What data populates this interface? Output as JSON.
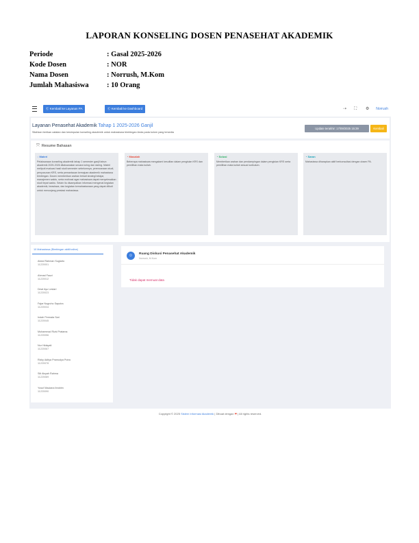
{
  "report": {
    "title": "LAPORAN KONSELING DOSEN PENASEHAT AKADEMIK",
    "fields": [
      {
        "label": "Periode",
        "value": ": Gasal 2025-2026"
      },
      {
        "label": "Kode Dosen",
        "value": ": NOR"
      },
      {
        "label": "Nama Dosen",
        "value": ": Norrush, M.Kom"
      },
      {
        "label": "Jumlah Mahasiswa",
        "value": ": 10 Orang"
      }
    ]
  },
  "app": {
    "topbar": {
      "btn1": "Ⓒ Kembali ke Layanan PA",
      "btn2": "Ⓒ Kembali ke Dashboard",
      "user": "Norrush"
    },
    "header": {
      "title": "Layanan Penasehat Akademik",
      "title_highlight": "Tahap 1 2025-2026 Ganjil",
      "subtitle": "Silahkan berikan catatan dan kesimpulan konseling akademik untuk mahasiswa bimbingan Anda pada kolom yang tersedia",
      "updated": "Update terakhir: 17/09/2025 15:39",
      "back": "Kembali"
    },
    "summary": {
      "title": "Resume Bahasan",
      "cols": [
        {
          "heading": "Materi",
          "color": "#3b7ddd",
          "text": "Pelaksanaan konseling akademik tahap 1 semester ganjil tahun akademik 2025-2026 dilaksanakan secara luring dan daring. Materi meliputi evaluasi hasil studi semester sebelumnya, perencanaan studi, penyusunan KRS, serta pemantauan kemajuan akademik mahasiswa bimbingan. Dosen memberikan arahan terkait strategi belajar, manajemen waktu, serta motivasi agar mahasiswa dapat menyelesaikan studi tepat waktu. Selain itu disampaikan informasi mengenai kegiatan akademik, beasiswa, dan kegiatan kemahasiswaan yang dapat diikuti untuk menunjang prestasi mahasiswa."
        },
        {
          "heading": "Masalah",
          "color": "#e74c3c",
          "text": "Beberapa mahasiswa mengalami kesulitan dalam pengisian KRS dan pemilihan mata kuliah."
        },
        {
          "heading": "Solusi",
          "color": "#27ae60",
          "text": "Memberikan arahan dan pendampingan dalam pengisian KRS serta pemilihan mata kuliah sesuai kurikulum."
        },
        {
          "heading": "Saran",
          "color": "#17a2b8",
          "text": "Mahasiswa diharapkan aktif berkonsultasi dengan dosen PA."
        }
      ]
    },
    "sidebar": {
      "tab": "10 Mahasiswa (Bimbingan aktif/online)",
      "students": [
        {
          "name": "Abdul Rahman Sugiarto",
          "nim": "11220001"
        },
        {
          "name": "Ahmad Fauzi",
          "nim": "11220012"
        },
        {
          "name": "Dewi Ayu Lestari",
          "nim": "11220023"
        },
        {
          "name": "Fajar Nugroho Saputra",
          "nim": "11220034"
        },
        {
          "name": "Indah Permata Sari",
          "nim": "11220045"
        },
        {
          "name": "Muhammad Rizki Pratama",
          "nim": "11220056"
        },
        {
          "name": "Nur Hidayati",
          "nim": "11220067"
        },
        {
          "name": "Rizky Aditya Pramudya Putra",
          "nim": "11220078"
        },
        {
          "name": "Siti Aisyah Rahma",
          "nim": "11220089"
        },
        {
          "name": "Yusuf Maulana Ibrahim",
          "nim": "11220090"
        }
      ]
    },
    "chat": {
      "title": "Ruang Diskusi Penasehat Akademik",
      "subtitle": "Norrush, M.Kom",
      "empty": "Tidak dapat memuat data"
    },
    "footer": {
      "pre": "Copyright © 2025 ",
      "org": "Sistem Informasi Akademik",
      "mid": " | Dibuat dengan ",
      "heart": "❤",
      "post": " | All rights reserved."
    }
  }
}
